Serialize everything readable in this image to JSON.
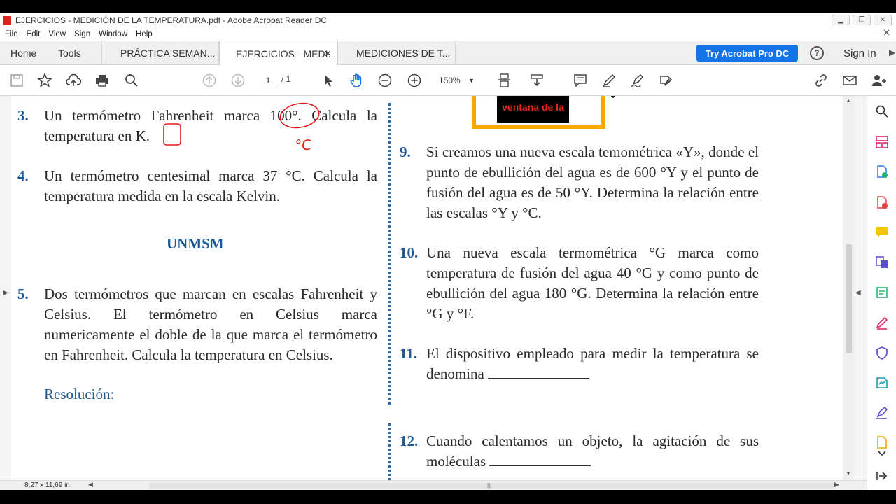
{
  "window": {
    "title": "EJERCICIOS - MEDICIÓN DE LA TEMPERATURA.pdf - Adobe Acrobat Reader DC"
  },
  "menu": [
    "File",
    "Edit",
    "View",
    "Sign",
    "Window",
    "Help"
  ],
  "tabs": {
    "home": "Home",
    "tools": "Tools",
    "docs": [
      {
        "label": "PRÁCTICA SEMAN...",
        "active": false
      },
      {
        "label": "EJERCICIOS - MEDI...",
        "active": true
      },
      {
        "label": "MEDICIONES DE T...",
        "active": false
      }
    ],
    "try_pro": "Try Acrobat Pro DC",
    "sign_in": "Sign In"
  },
  "toolbar": {
    "page_current": "1",
    "page_total": "/ 1",
    "zoom": "150%"
  },
  "document": {
    "left": [
      {
        "num": "3.",
        "text": "Un termómetro Fahrenheit marca 100°. Calcula la temperatura en K."
      },
      {
        "num": "4.",
        "text": "Un termómetro centesimal marca 37 °C. Calcula la temperatura medida en la escala Kelvin."
      },
      {
        "heading": "UNMSM"
      },
      {
        "num": "5.",
        "text": "Dos termómetros que marcan en escalas Fahrenheit y Celsius. El termómetro en Celsius marca numericamente el doble de la que marca el termómetro en Fahrenheit. Calcula la temperatura en Celsius."
      },
      {
        "resolution": "Resolución:"
      }
    ],
    "right": [
      {
        "num": "9.",
        "text": "Si creamos una nueva escala temométrica «Y», donde el punto de ebullición del agua es de 600 °Y y el punto de fusión del agua es de 50 °Y. Determina la relación entre las escalas °Y y °C."
      },
      {
        "num": "10.",
        "text": "Una nueva escala termométrica °G marca como temperatura de fusión del agua 40 °G y como punto de ebullición del agua 180 °G. Determina la relación entre °G y °F."
      },
      {
        "num": "11.",
        "text": "El dispositivo empleado para medir la temperatura se denomina"
      },
      {
        "num": "12.",
        "text": "Cuando calentamos un objeto, la agitación de sus moléculas"
      }
    ],
    "banner_text": "ventana de la",
    "annotation": "°C"
  },
  "status": {
    "page_size": "8,27 x 11,69 in"
  },
  "colors": {
    "accent_blue": "#1473e6",
    "question_blue": "#1f5a96",
    "annotation_red": "#e01b1b",
    "banner_orange": "#f5a800"
  }
}
